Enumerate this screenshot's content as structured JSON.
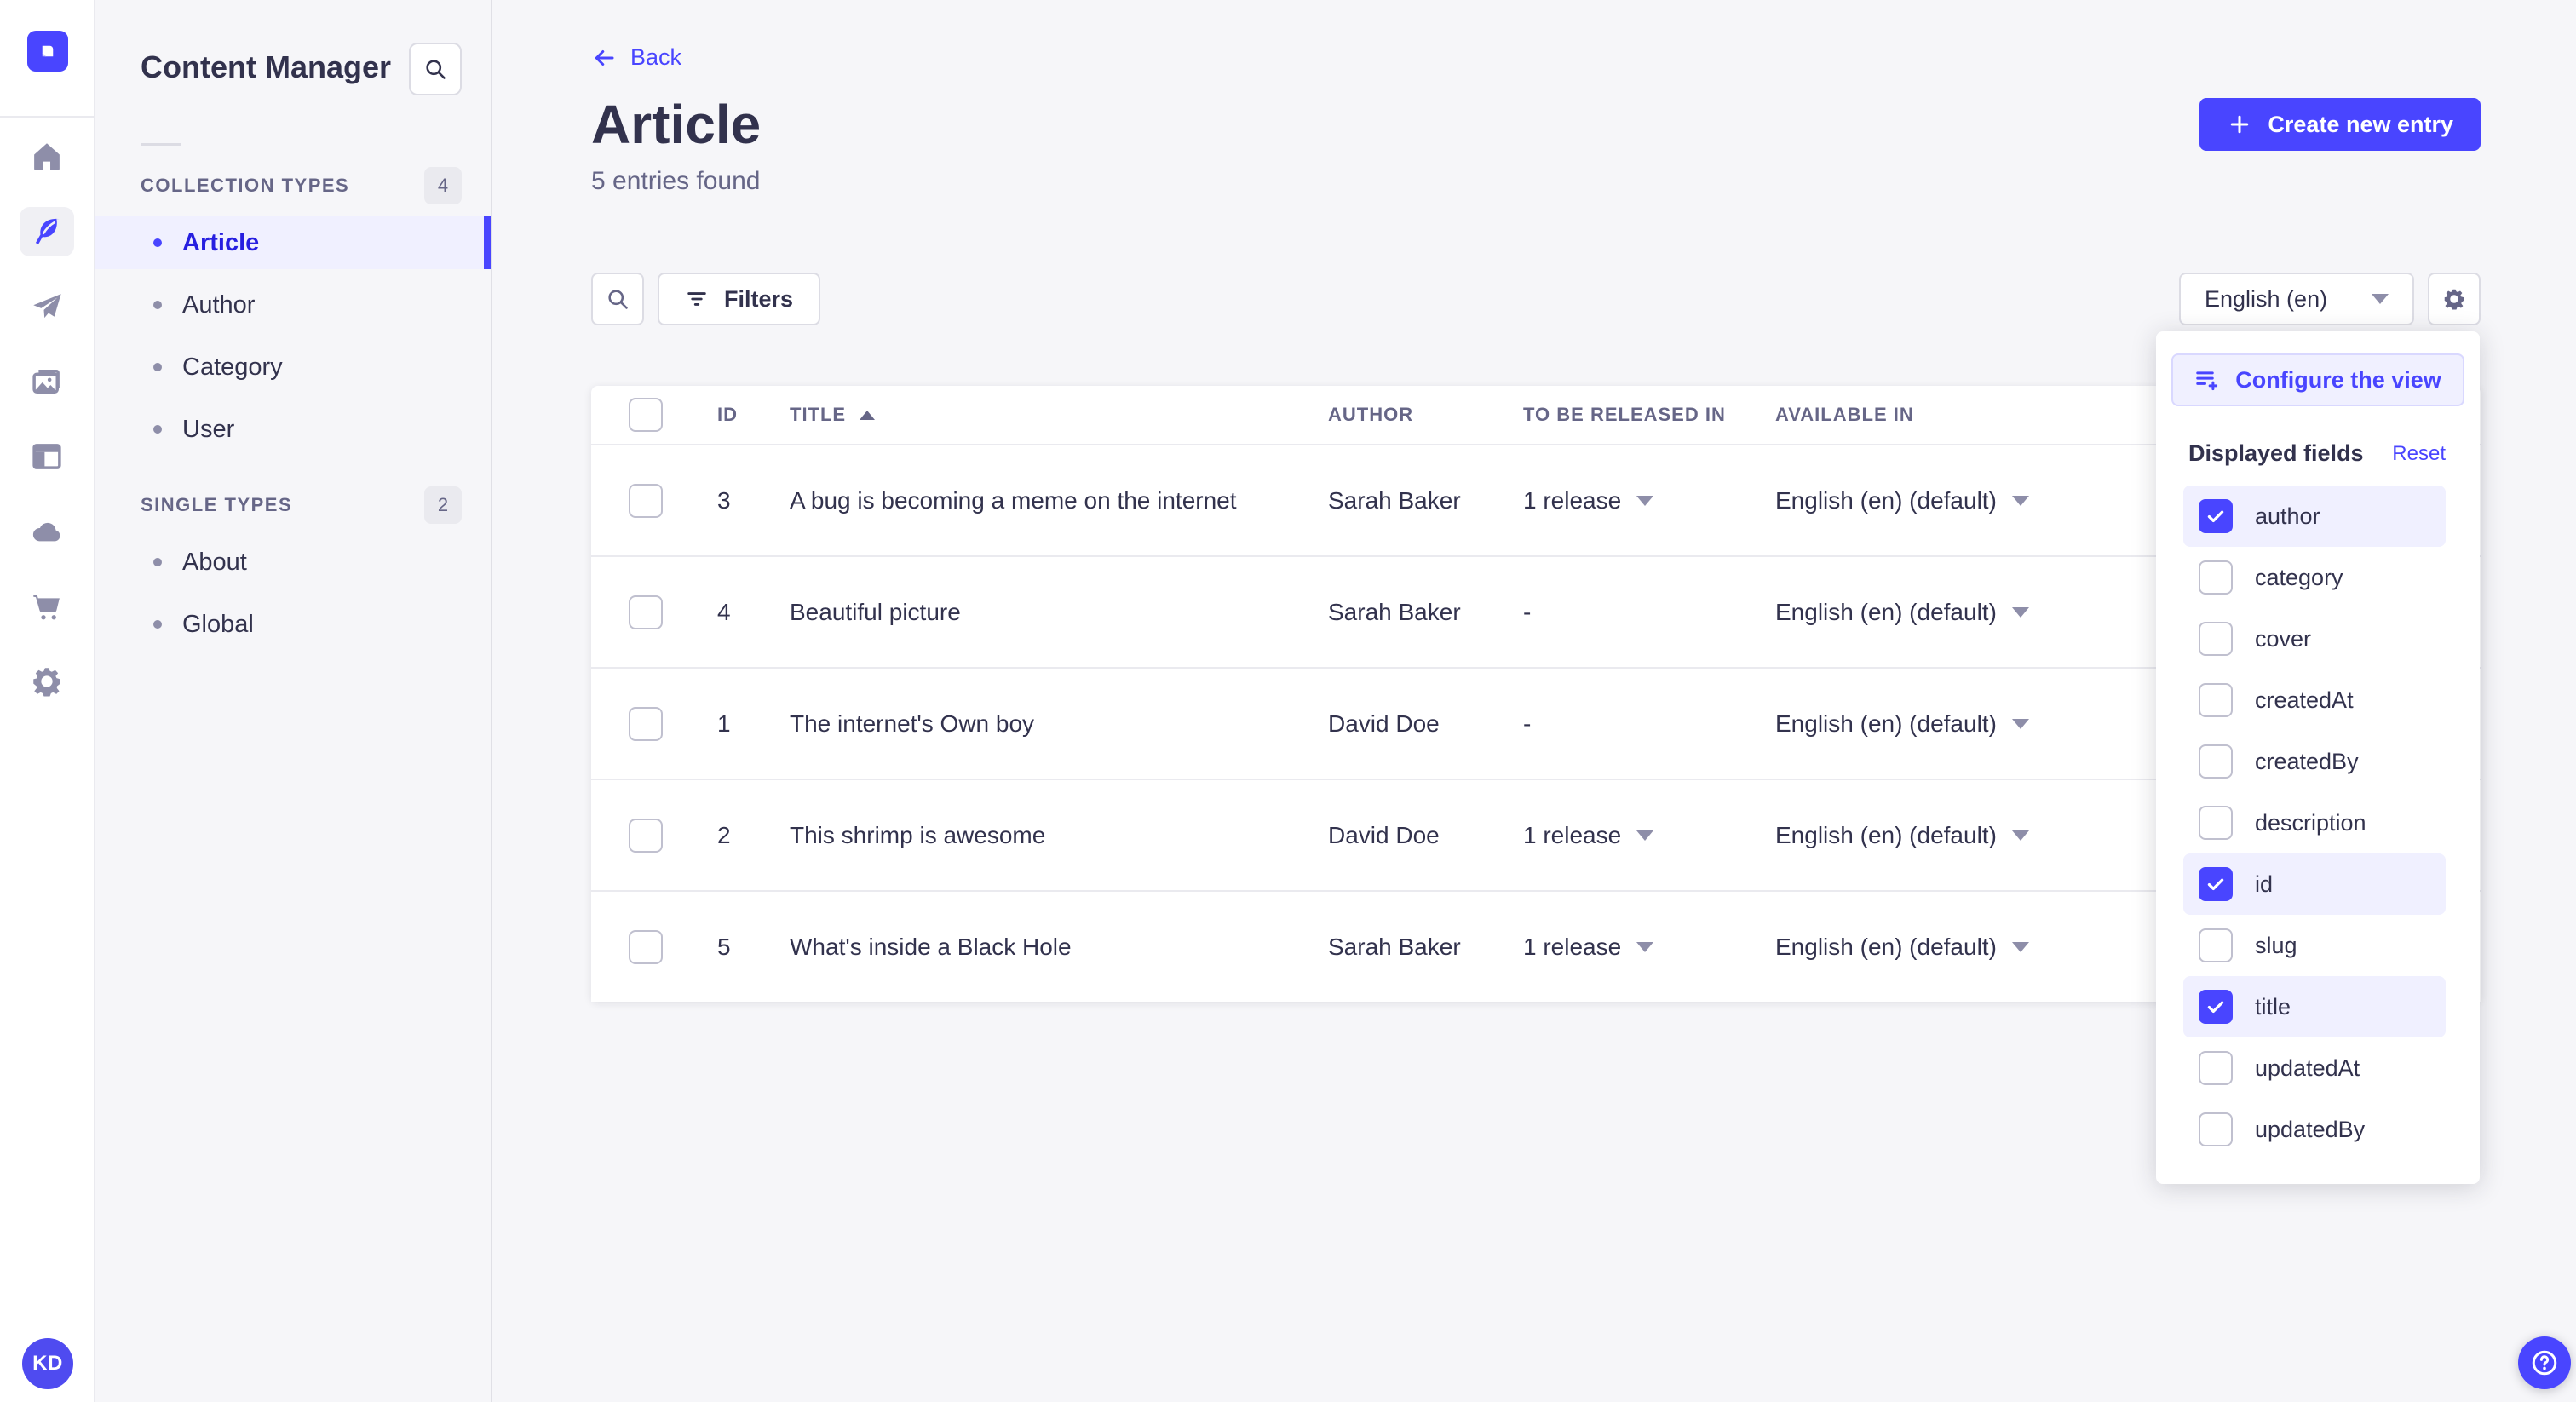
{
  "sidebar": {
    "title": "Content Manager",
    "sections": [
      {
        "label": "COLLECTION TYPES",
        "count": "4",
        "items": [
          {
            "label": "Article",
            "active": true
          },
          {
            "label": "Author",
            "active": false
          },
          {
            "label": "Category",
            "active": false
          },
          {
            "label": "User",
            "active": false
          }
        ]
      },
      {
        "label": "SINGLE TYPES",
        "count": "2",
        "items": [
          {
            "label": "About",
            "active": false
          },
          {
            "label": "Global",
            "active": false
          }
        ]
      }
    ]
  },
  "header": {
    "back_label": "Back",
    "title": "Article",
    "subtitle": "5 entries found",
    "create_label": "Create new entry"
  },
  "toolbar": {
    "filters_label": "Filters",
    "locale_value": "English (en)"
  },
  "table": {
    "columns": {
      "id": "ID",
      "title": "TITLE",
      "author": "AUTHOR",
      "release": "TO BE RELEASED IN",
      "available": "AVAILABLE IN"
    },
    "rows": [
      {
        "id": "3",
        "title": "A bug is becoming a meme on the internet",
        "author": "Sarah Baker",
        "release": "1 release",
        "release_caret": true,
        "available": "English (en) (default)"
      },
      {
        "id": "4",
        "title": "Beautiful picture",
        "author": "Sarah Baker",
        "release": "-",
        "release_caret": false,
        "available": "English (en) (default)"
      },
      {
        "id": "1",
        "title": "The internet's Own boy",
        "author": "David Doe",
        "release": "-",
        "release_caret": false,
        "available": "English (en) (default)"
      },
      {
        "id": "2",
        "title": "This shrimp is awesome",
        "author": "David Doe",
        "release": "1 release",
        "release_caret": true,
        "available": "English (en) (default)"
      },
      {
        "id": "5",
        "title": "What's inside a Black Hole",
        "author": "Sarah Baker",
        "release": "1 release",
        "release_caret": true,
        "available": "English (en) (default)"
      }
    ]
  },
  "popover": {
    "configure_label": "Configure the view",
    "fields_title": "Displayed fields",
    "reset_label": "Reset",
    "fields": [
      {
        "label": "author",
        "checked": true
      },
      {
        "label": "category",
        "checked": false
      },
      {
        "label": "cover",
        "checked": false
      },
      {
        "label": "createdAt",
        "checked": false
      },
      {
        "label": "createdBy",
        "checked": false
      },
      {
        "label": "description",
        "checked": false
      },
      {
        "label": "id",
        "checked": true
      },
      {
        "label": "slug",
        "checked": false
      },
      {
        "label": "title",
        "checked": true
      },
      {
        "label": "updatedAt",
        "checked": false
      },
      {
        "label": "updatedBy",
        "checked": false
      }
    ]
  },
  "user": {
    "initials": "KD"
  },
  "colors": {
    "primary": "#4945ff",
    "primary_dark": "#271fe0",
    "primary_light": "#f0f0ff",
    "text": "#32324d",
    "muted": "#666687",
    "page_bg": "#f6f6f9"
  }
}
